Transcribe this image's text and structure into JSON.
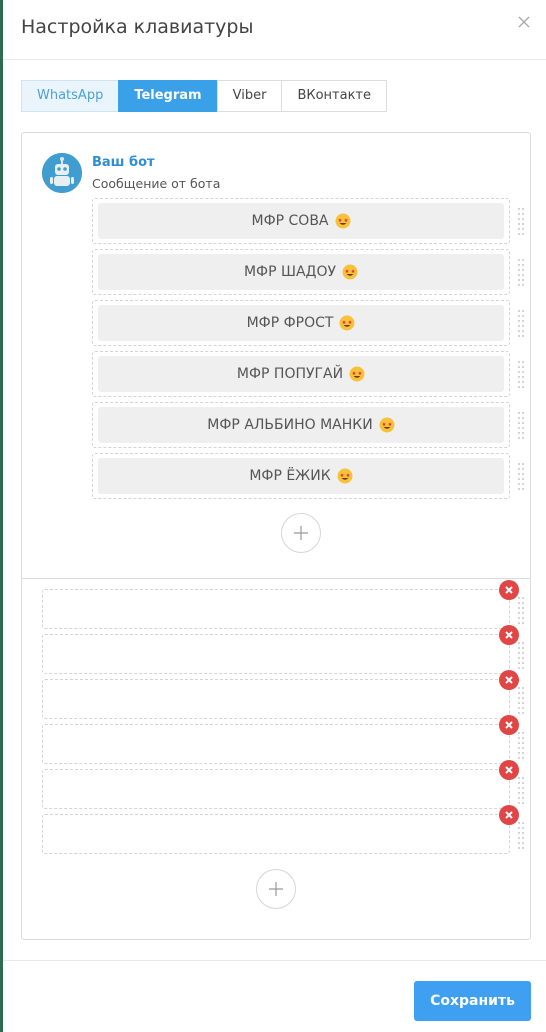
{
  "modal": {
    "title": "Настройка клавиатуры"
  },
  "tabs": [
    {
      "label": "WhatsApp"
    },
    {
      "label": "Telegram"
    },
    {
      "label": "Viber"
    },
    {
      "label": "ВКонтакте"
    }
  ],
  "active_tab": "Telegram",
  "bot": {
    "name": "Ваш бот",
    "message": "Сообщение от бота"
  },
  "inline_buttons": [
    {
      "label": "МФР СОВА"
    },
    {
      "label": "МФР ШАДОУ"
    },
    {
      "label": "МФР ФРОСТ"
    },
    {
      "label": "МФР ПОПУГАЙ"
    },
    {
      "label": "МФР АЛЬБИНО МАНКИ"
    },
    {
      "label": "МФР ЁЖИК"
    }
  ],
  "keyboard_rows_count": 6,
  "icons": {
    "close": "close-icon",
    "avatar": "robot-icon",
    "emoji": "star-struck-emoji-icon",
    "grip": "drag-handle-icon",
    "add": "plus-icon",
    "delete": "delete-x-icon"
  },
  "colors": {
    "accent": "#3aa0e8",
    "bot_name": "#2e8fd4",
    "delete": "#e04646",
    "button_bg": "#efefef"
  },
  "footer": {
    "save_label": "Сохранить"
  }
}
